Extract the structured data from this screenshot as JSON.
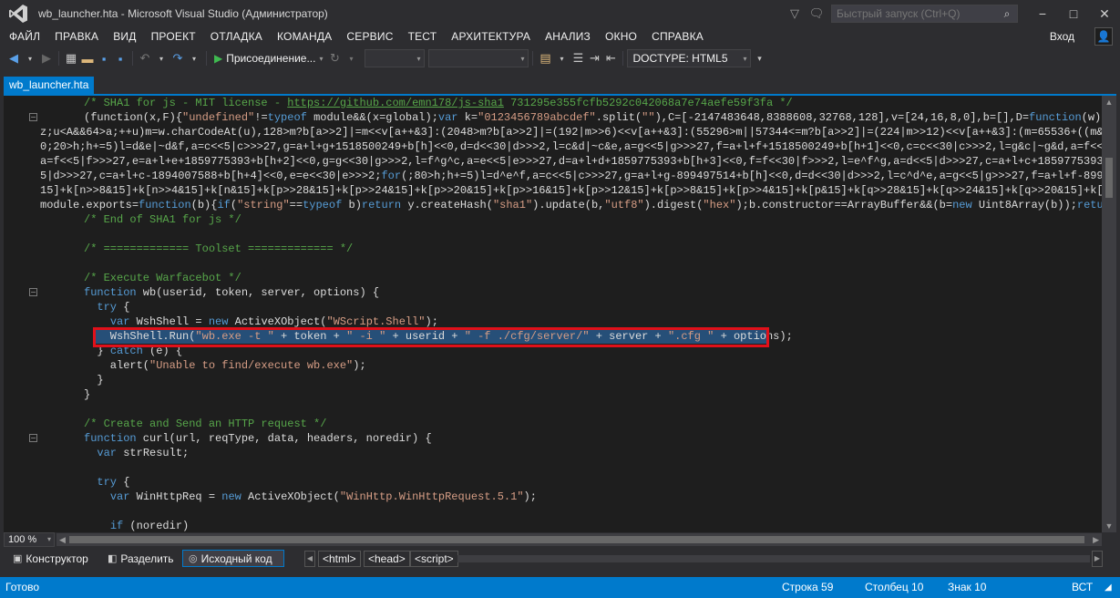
{
  "window": {
    "title": "wb_launcher.hta - Microsoft Visual Studio (Администратор)",
    "quick_launch_placeholder": "Быстрый запуск (Ctrl+Q)"
  },
  "menu": [
    "ФАЙЛ",
    "ПРАВКА",
    "ВИД",
    "ПРОЕКТ",
    "ОТЛАДКА",
    "КОМАНДА",
    "СЕРВИС",
    "ТЕСТ",
    "АРХИТЕКТУРА",
    "АНАЛИЗ",
    "ОКНО",
    "СПРАВКА"
  ],
  "login_label": "Вход",
  "toolbar": {
    "attach_label": "Присоединение...",
    "doctype_label": "DOCTYPE: HTML5"
  },
  "tab": {
    "label": "wb_launcher.hta"
  },
  "code_lines": [
    [
      [
        "c-comment",
        "/* SHA1 for js - MIT license - "
      ],
      [
        "c-link",
        "https://github.com/emn178/js-sha1"
      ],
      [
        "c-comment",
        " 731295e355fcfb5292c042068a7e74aefe59f3fa */"
      ]
    ],
    [
      [
        "c-plain",
        "(function(x,F){"
      ],
      [
        "c-str",
        "\"undefined\""
      ],
      [
        "c-plain",
        "!="
      ],
      [
        "c-kw",
        "typeof"
      ],
      [
        "c-plain",
        " module&&(x=global);"
      ],
      [
        "c-kw",
        "var"
      ],
      [
        "c-plain",
        " k="
      ],
      [
        "c-str",
        "\"0123456789abcdef\""
      ],
      [
        "c-plain",
        ".split("
      ],
      [
        "c-str",
        "\"\""
      ],
      [
        "c-plain",
        "),C=[-2147483648,8388608,32768,128],v=[24,16,8,0],b=[],D="
      ],
      [
        "c-kw",
        "function"
      ],
      [
        "c-plain",
        "(w){"
      ],
      [
        "c-kw",
        "var"
      ]
    ],
    [
      [
        "c-plain",
        "z;u<A&&64>a;++u)m=w.charCodeAt(u),128>m?b[a>>2]|=m<<v[a++&3]:(2048>m?b[a>>2]|=(192|m>>6)<<v[a++&3]:(55296>m||57344<=m?b[a>>2]|=(224|m>>12)<<v[a++&3]:(m=65536+((m&1023"
      ]
    ],
    [
      [
        "c-plain",
        "0;20>h;h+=5)l=d&e|~d&f,a=c<<5|c>>>27,g=a+l+g+1518500249+b[h]<<0,d=d<<30|d>>>2,l=c&d|~c&e,a=g<<5|g>>>27,f=a+l+f+1518500249+b[h+1]<<0,c=c<<30|c>>>2,l=g&c|~g&d,a=f<<5|f>"
      ]
    ],
    [
      [
        "c-plain",
        "a=f<<5|f>>>27,e=a+l+e+1859775393+b[h+2]<<0,g=g<<30|g>>>2,l=f^g^c,a=e<<5|e>>>27,d=a+l+d+1859775393+b[h+3]<<0,f=f<<30|f>>>2,l=e^f^g,a=d<<5|d>>>27,c=a+l+c+1859775393+b[h"
      ]
    ],
    [
      [
        "c-plain",
        "5|d>>>27,c=a+l+c-1894007588+b[h+4]<<0,e=e<<30|e>>>2;"
      ],
      [
        "c-kw",
        "for"
      ],
      [
        "c-plain",
        "(;80>h;h+=5)l=d^e^f,a=c<<5|c>>>27,g=a+l+g-899497514+b[h]<<0,d=d<<30|d>>>2,l=c^d^e,a=g<<5|g>>>27,f=a+l+f-8994975"
      ]
    ],
    [
      [
        "c-plain",
        "15]+k[n>>8&15]+k[n>>4&15]+k[n&15]+k[p>>28&15]+k[p>>24&15]+k[p>>20&15]+k[p>>16&15]+k[p>>12&15]+k[p>>8&15]+k[p>>4&15]+k[p&15]+k[q>>28&15]+k[q>>24&15]+k[q>>20&15]+k[q>>1"
      ]
    ],
    [
      [
        "c-plain",
        "module.exports="
      ],
      [
        "c-kw",
        "function"
      ],
      [
        "c-plain",
        "(b){"
      ],
      [
        "c-kw",
        "if"
      ],
      [
        "c-plain",
        "("
      ],
      [
        "c-str",
        "\"string\""
      ],
      [
        "c-plain",
        "=="
      ],
      [
        "c-kw",
        "typeof"
      ],
      [
        "c-plain",
        " b)"
      ],
      [
        "c-kw",
        "return"
      ],
      [
        "c-plain",
        " y.createHash("
      ],
      [
        "c-str",
        "\"sha1\""
      ],
      [
        "c-plain",
        ").update(b,"
      ],
      [
        "c-str",
        "\"utf8\""
      ],
      [
        "c-plain",
        ").digest("
      ],
      [
        "c-str",
        "\"hex\""
      ],
      [
        "c-plain",
        ");b.constructor==ArrayBuffer&&(b="
      ],
      [
        "c-kw",
        "new"
      ],
      [
        "c-plain",
        " Uint8Array(b));"
      ],
      [
        "c-kw",
        "return"
      ],
      [
        "c-plain",
        " y"
      ]
    ],
    [
      [
        "c-comment",
        "/* End of SHA1 for js */"
      ]
    ],
    [],
    [
      [
        "c-comment",
        "/* ============= Toolset ============= */"
      ]
    ],
    [],
    [
      [
        "c-comment",
        "/* Execute Warfacebot */"
      ]
    ],
    [
      [
        "c-kw",
        "function"
      ],
      [
        "c-plain",
        " wb(userid, token, server, options) {"
      ]
    ],
    [
      [
        "c-plain",
        "  "
      ],
      [
        "c-kw",
        "try"
      ],
      [
        "c-plain",
        " {"
      ]
    ],
    [
      [
        "c-plain",
        "    "
      ],
      [
        "c-kw",
        "var"
      ],
      [
        "c-plain",
        " WshShell = "
      ],
      [
        "c-kw",
        "new"
      ],
      [
        "c-plain",
        " ActiveXObject("
      ],
      [
        "c-str",
        "\"WScript.Shell\""
      ],
      [
        "c-plain",
        ");"
      ]
    ],
    [
      [
        "c-plain",
        "    WshShell.Run("
      ],
      [
        "c-str",
        "\"wb.exe -t \""
      ],
      [
        "c-plain",
        " + token + "
      ],
      [
        "c-str",
        "\" -i \""
      ],
      [
        "c-plain",
        " + userid + "
      ],
      [
        "c-str",
        "\" -f ./cfg/server/\""
      ],
      [
        "c-plain",
        " + server + "
      ],
      [
        "c-str",
        "\".cfg \""
      ],
      [
        "c-plain",
        " + options);"
      ]
    ],
    [
      [
        "c-plain",
        "  } "
      ],
      [
        "c-kw",
        "catch"
      ],
      [
        "c-plain",
        " (e) {"
      ]
    ],
    [
      [
        "c-plain",
        "    alert("
      ],
      [
        "c-str",
        "\"Unable to find/execute wb.exe\""
      ],
      [
        "c-plain",
        ");"
      ]
    ],
    [
      [
        "c-plain",
        "  }"
      ]
    ],
    [
      [
        "c-plain",
        "}"
      ]
    ],
    [],
    [
      [
        "c-comment",
        "/* Create and Send an HTTP request */"
      ]
    ],
    [
      [
        "c-kw",
        "function"
      ],
      [
        "c-plain",
        " curl(url, reqType, data, headers, noredir) {"
      ]
    ],
    [
      [
        "c-plain",
        "  "
      ],
      [
        "c-kw",
        "var"
      ],
      [
        "c-plain",
        " strResult;"
      ]
    ],
    [],
    [
      [
        "c-plain",
        "  "
      ],
      [
        "c-kw",
        "try"
      ],
      [
        "c-plain",
        " {"
      ]
    ],
    [
      [
        "c-plain",
        "    "
      ],
      [
        "c-kw",
        "var"
      ],
      [
        "c-plain",
        " WinHttpReq = "
      ],
      [
        "c-kw",
        "new"
      ],
      [
        "c-plain",
        " ActiveXObject("
      ],
      [
        "c-str",
        "\"WinHttp.WinHttpRequest.5.1\""
      ],
      [
        "c-plain",
        ");"
      ]
    ],
    [],
    [
      [
        "c-plain",
        "    "
      ],
      [
        "c-kw",
        "if"
      ],
      [
        "c-plain",
        " (noredir)"
      ]
    ]
  ],
  "zoom": "100 %",
  "views": {
    "design": "Конструктор",
    "split": "Разделить",
    "source": "Исходный код"
  },
  "breadcrumbs": [
    "<html>",
    "<head>",
    "<script>"
  ],
  "status": {
    "ready": "Готово",
    "line": "Строка 59",
    "col": "Столбец 10",
    "ch": "Знак 10",
    "ins": "ВСТ"
  }
}
